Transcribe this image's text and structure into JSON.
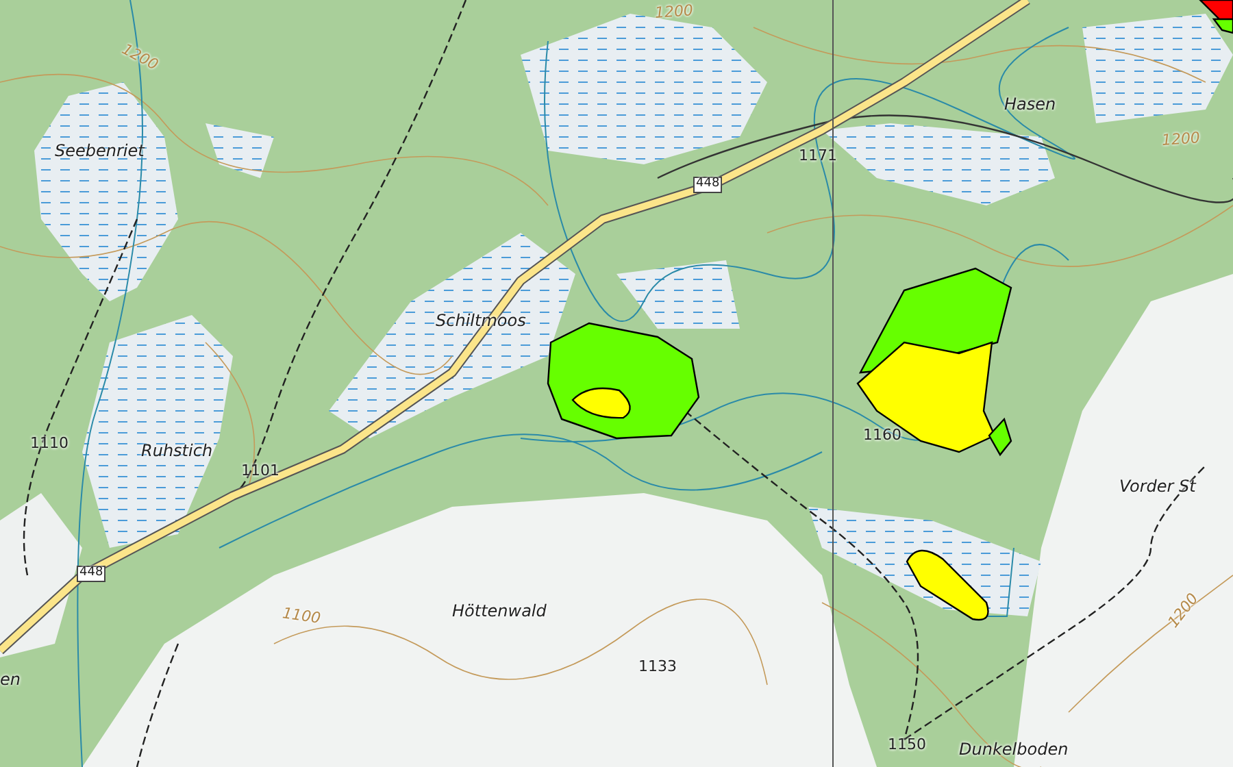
{
  "map": {
    "labels": [
      {
        "kind": "place",
        "text": "Seebenriet"
      },
      {
        "kind": "contour",
        "text": "1200"
      },
      {
        "kind": "contour",
        "text": "1200"
      },
      {
        "kind": "spot",
        "text": "1171"
      },
      {
        "kind": "place",
        "text": "Hasen"
      },
      {
        "kind": "contour",
        "text": "1200"
      },
      {
        "kind": "shield",
        "text": "448"
      },
      {
        "kind": "place",
        "text": "Schiltmoos"
      },
      {
        "kind": "spot",
        "text": "1110"
      },
      {
        "kind": "place",
        "text": "Ruhstich"
      },
      {
        "kind": "spot",
        "text": "1101"
      },
      {
        "kind": "shield",
        "text": "448"
      },
      {
        "kind": "place",
        "text": "Höttenwald"
      },
      {
        "kind": "contour",
        "text": "1100"
      },
      {
        "kind": "spot",
        "text": "1133"
      },
      {
        "kind": "spot",
        "text": "1160"
      },
      {
        "kind": "place",
        "text": "Vorder St"
      },
      {
        "kind": "contour",
        "text": "1200"
      },
      {
        "kind": "spot",
        "text": "1150"
      },
      {
        "kind": "place",
        "text": "Dunkelboden"
      },
      {
        "kind": "place",
        "text": "en"
      }
    ],
    "zones": [
      {
        "color": "#66ff00"
      },
      {
        "color": "#ffff00"
      },
      {
        "color": "#66ff00"
      },
      {
        "color": "#ffff00"
      },
      {
        "color": "#66ff00"
      },
      {
        "color": "#ffff00"
      },
      {
        "color": "#ff0000"
      },
      {
        "color": "#66ff00"
      }
    ]
  }
}
